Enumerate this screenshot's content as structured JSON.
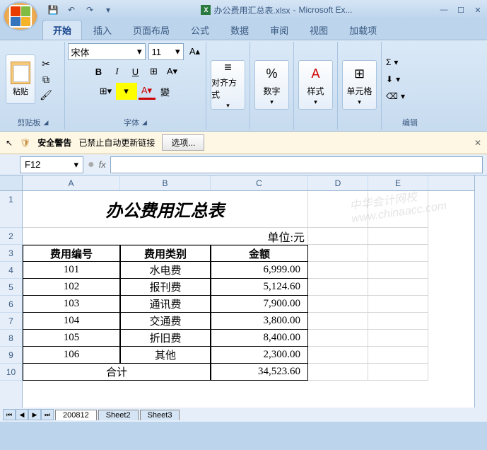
{
  "window": {
    "filename": "办公费用汇总表.xlsx",
    "app": "Microsoft Ex..."
  },
  "qat": {
    "save": "💾",
    "undo": "↶",
    "redo": "↷"
  },
  "tabs": [
    "开始",
    "插入",
    "页面布局",
    "公式",
    "数据",
    "审阅",
    "视图",
    "加载项"
  ],
  "ribbon": {
    "clipboard": {
      "paste": "粘贴",
      "label": "剪贴板"
    },
    "font": {
      "name": "宋体",
      "size": "11",
      "label": "字体"
    },
    "align": {
      "label": "对齐方式"
    },
    "number": {
      "label": "数字",
      "percent": "%"
    },
    "style": {
      "label": "样式"
    },
    "cells": {
      "label": "单元格"
    },
    "edit": {
      "label": "编辑",
      "sigma": "Σ"
    }
  },
  "security": {
    "title": "安全警告",
    "msg": "已禁止自动更新链接",
    "options": "选项..."
  },
  "formula": {
    "namebox": "F12",
    "fx": "fx"
  },
  "cols": [
    "A",
    "B",
    "C",
    "D",
    "E"
  ],
  "sheet": {
    "title": "办公费用汇总表",
    "unit": "单位:元",
    "headers": [
      "费用编号",
      "费用类别",
      "金额"
    ],
    "rows": [
      {
        "id": "101",
        "cat": "水电费",
        "amt": "6,999.00"
      },
      {
        "id": "102",
        "cat": "报刊费",
        "amt": "5,124.60"
      },
      {
        "id": "103",
        "cat": "通讯费",
        "amt": "7,900.00"
      },
      {
        "id": "104",
        "cat": "交通费",
        "amt": "3,800.00"
      },
      {
        "id": "105",
        "cat": "折旧费",
        "amt": "8,400.00"
      },
      {
        "id": "106",
        "cat": "其他",
        "amt": "2,300.00"
      }
    ],
    "total_label": "合计",
    "total_amt": "34,523.60"
  },
  "sheettabs": [
    "200812",
    "Sheet2",
    "Sheet3"
  ],
  "watermark": {
    "cn": "中华会计网校",
    "url": "www.chinaacc.com"
  }
}
